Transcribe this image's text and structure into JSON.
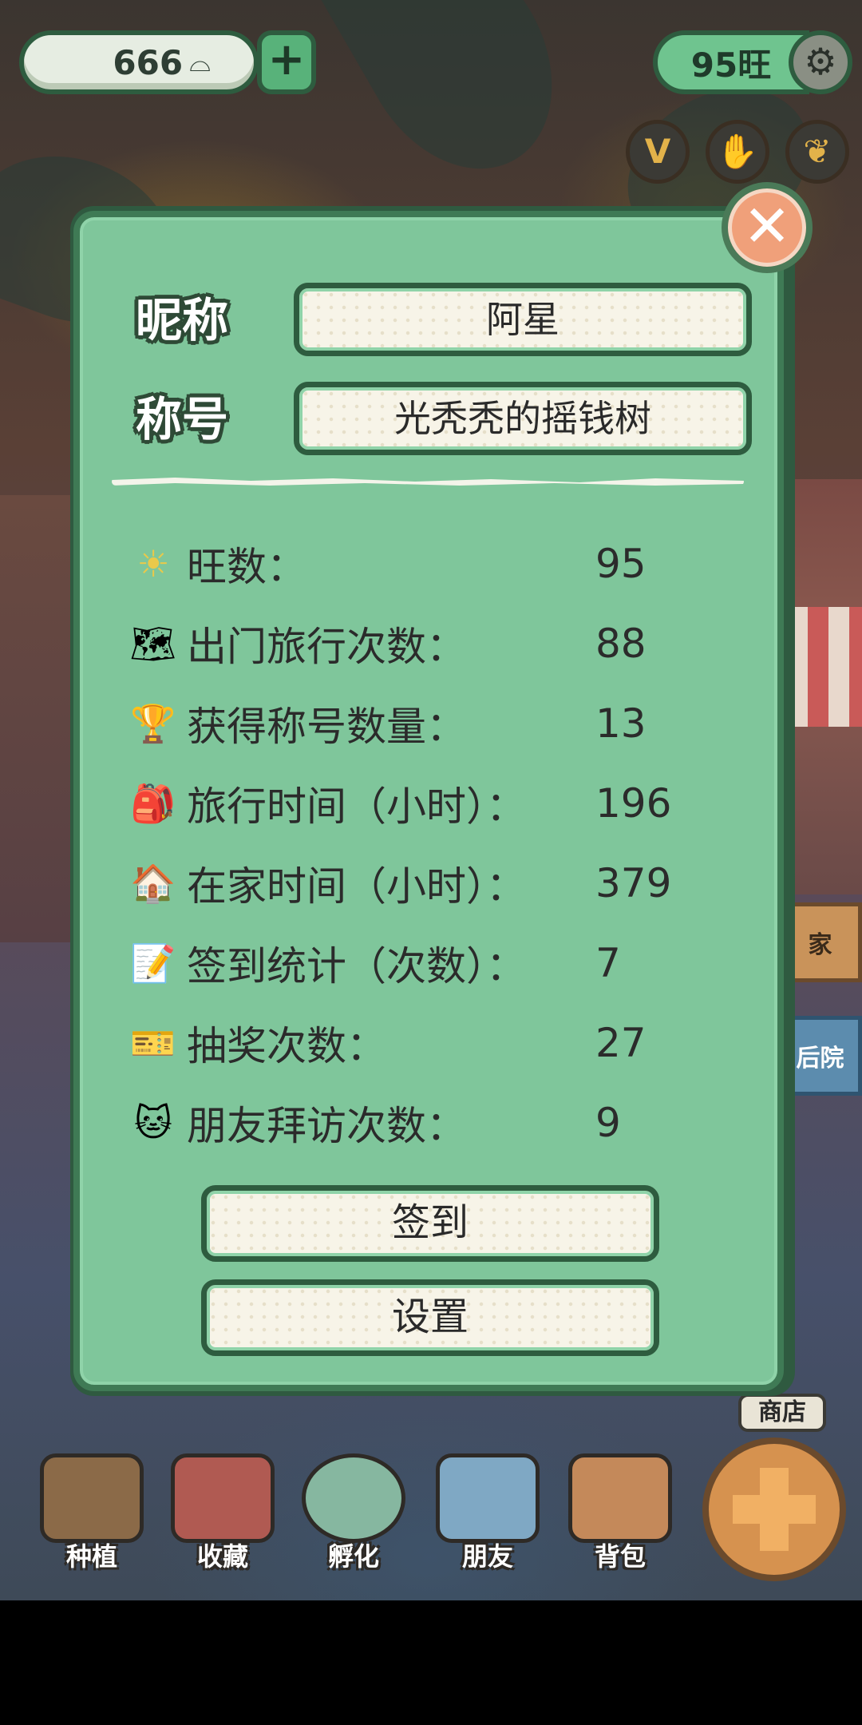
{
  "top_bar": {
    "coins": "666",
    "coin_icon": "ingot-icon",
    "plus_label": "+",
    "wang": "95旺",
    "gear_icon": "⚙"
  },
  "quick_buttons": [
    {
      "label": "V",
      "name": "vip-button",
      "color": "#e2b24a"
    },
    {
      "label": "✋",
      "name": "hand-button",
      "color": "#7fb3d6"
    },
    {
      "label": "❦",
      "name": "ginkgo-button",
      "color": "#e2b24a"
    }
  ],
  "side_tags": {
    "home": "家",
    "backyard": "后院",
    "shop": "商店"
  },
  "profile_dialog": {
    "close_label": "✕",
    "nickname_label": "昵称",
    "nickname_value": "阿星",
    "title_label": "称号",
    "title_value": "光秃秃的摇钱树",
    "stats": [
      {
        "icon": "☀",
        "label": "旺数：",
        "value": "95"
      },
      {
        "icon": "🗺",
        "label": "出门旅行次数：",
        "value": "88"
      },
      {
        "icon": "🏆",
        "label": "获得称号数量：",
        "value": "13"
      },
      {
        "icon": "🎒",
        "label": "旅行时间（小时）：",
        "value": "196"
      },
      {
        "icon": "🏠",
        "label": "在家时间（小时）：",
        "value": "379"
      },
      {
        "icon": "📝",
        "label": "签到统计（次数）：",
        "value": "7"
      },
      {
        "icon": "🎫",
        "label": "抽奖次数：",
        "value": "27"
      },
      {
        "icon": "🐱",
        "label": "朋友拜访次数：",
        "value": "9"
      }
    ],
    "checkin_label": "签到",
    "settings_label": "设置"
  },
  "bottom_nav": [
    {
      "label": "种植",
      "name": "nav-plant",
      "color": "#8b6a48"
    },
    {
      "label": "收藏",
      "name": "nav-collection",
      "color": "#b05a52"
    },
    {
      "label": "孵化",
      "name": "nav-hatch",
      "color": "#86b7a0"
    },
    {
      "label": "朋友",
      "name": "nav-friends",
      "color": "#7fa8c4"
    },
    {
      "label": "背包",
      "name": "nav-backpack",
      "color": "#c4895a"
    }
  ]
}
